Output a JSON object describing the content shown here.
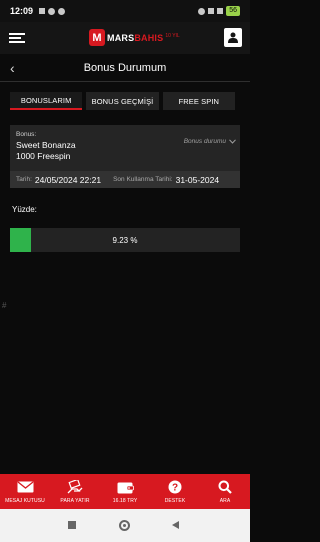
{
  "status_bar": {
    "time": "12:09",
    "battery": "56"
  },
  "header": {
    "logo_letter": "M",
    "logo_part1": "MARS",
    "logo_part2": "BAHIS",
    "logo_sup": "10 YIL"
  },
  "page": {
    "title": "Bonus Durumum"
  },
  "tabs": [
    {
      "label": "BONUSLARIM",
      "active": true
    },
    {
      "label": "BONUS GEÇMİŞİ",
      "active": false
    },
    {
      "label": "FREE SPIN",
      "active": false
    }
  ],
  "bonus": {
    "label": "Bonus:",
    "name": "Sweet Bonanza",
    "amount": "1000 Freespin",
    "status_dropdown": "Bonus durumu",
    "date_label": "Tarih:",
    "date_value": "24/05/2024 22:21",
    "expiry_label": "Son Kullanma Tarihi:",
    "expiry_value": "31-05-2024"
  },
  "progress": {
    "label": "Yüzde:",
    "value_text": "9.23 %",
    "percent": 9.23
  },
  "bottom_nav": [
    {
      "label": "MESAJ KUTUSU",
      "icon": "envelope-icon"
    },
    {
      "label": "PARA YATIR",
      "icon": "money-hand-icon"
    },
    {
      "label": "16.18 TRY",
      "icon": "wallet-icon"
    },
    {
      "label": "DESTEK",
      "icon": "help-icon"
    },
    {
      "label": "ARA",
      "icon": "search-icon"
    }
  ],
  "colors": {
    "brand_red": "#d71920",
    "progress_green": "#2fb34b",
    "background": "#0b0b0b"
  }
}
